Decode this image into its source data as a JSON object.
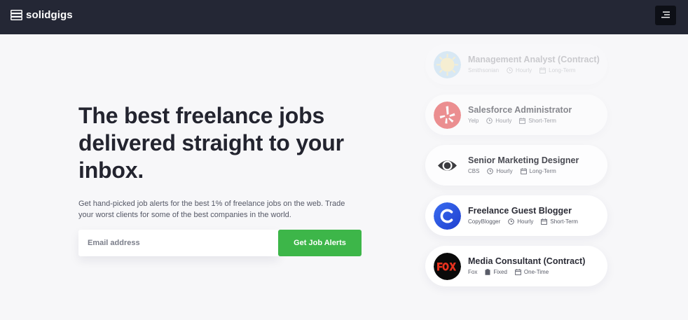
{
  "brand": {
    "name": "solidgigs"
  },
  "header": {
    "menu_icon": "menu-icon"
  },
  "hero": {
    "headline": "The best freelance jobs delivered straight to your inbox.",
    "subtext": "Get hand-picked job alerts for the best 1% of freelance jobs on the web. Trade your worst clients for some of the best companies in the world."
  },
  "signup": {
    "email_placeholder": "Email address",
    "cta_label": "Get Job Alerts"
  },
  "colors": {
    "header_bg": "#242735",
    "cta": "#3db649"
  },
  "jobs": [
    {
      "title": "Management Analyst (Contract)",
      "company": "Smithsonian",
      "pay": "Hourly",
      "duration": "Long-Term",
      "logo": "smithsonian-logo"
    },
    {
      "title": "Salesforce Administrator",
      "company": "Yelp",
      "pay": "Hourly",
      "duration": "Short-Term",
      "logo": "yelp-logo"
    },
    {
      "title": "Senior Marketing Designer",
      "company": "CBS",
      "pay": "Hourly",
      "duration": "Long-Term",
      "logo": "cbs-logo"
    },
    {
      "title": "Freelance Guest Blogger",
      "company": "CopyBlogger",
      "pay": "Hourly",
      "duration": "Short-Term",
      "logo": "copyblogger-logo"
    },
    {
      "title": "Media Consultant (Contract)",
      "company": "Fox",
      "pay": "Fixed",
      "duration": "One-Time",
      "logo": "fox-logo"
    }
  ]
}
